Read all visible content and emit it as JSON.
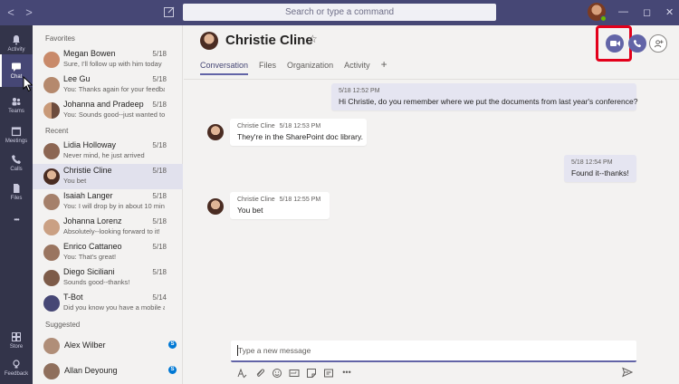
{
  "titlebar": {
    "search_placeholder": "Search or type a command",
    "back_glyph": "<",
    "forward_glyph": ">",
    "minimize_glyph": "—",
    "maximize_glyph": "◻",
    "close_glyph": "✕"
  },
  "rail": {
    "items": [
      {
        "label": "Activity",
        "icon": "bell-icon"
      },
      {
        "label": "Chat",
        "icon": "chat-icon",
        "active": true
      },
      {
        "label": "Teams",
        "icon": "teams-icon"
      },
      {
        "label": "Meetings",
        "icon": "calendar-icon"
      },
      {
        "label": "Calls",
        "icon": "phone-icon"
      },
      {
        "label": "Files",
        "icon": "file-icon"
      },
      {
        "label": "",
        "icon": "more-icon"
      },
      {
        "label": "Store",
        "icon": "store-icon"
      },
      {
        "label": "Feedback",
        "icon": "feedback-icon"
      }
    ],
    "more_glyph": "•••"
  },
  "chatlist": {
    "favorites_label": "Favorites",
    "recent_label": "Recent",
    "suggested_label": "Suggested",
    "favorites": [
      {
        "name": "Megan Bowen",
        "preview": "Sure, I'll follow up with him today",
        "date": "5/18"
      },
      {
        "name": "Lee Gu",
        "preview": "You: Thanks again for your feedback",
        "date": "5/18"
      },
      {
        "name": "Johanna and Pradeep",
        "preview": "You: Sounds good--just wanted to",
        "date": "5/18"
      }
    ],
    "recent": [
      {
        "name": "Lidia Holloway",
        "preview": "Never mind, he just arrived",
        "date": "5/18"
      },
      {
        "name": "Christie Cline",
        "preview": "You bet",
        "date": "5/18"
      },
      {
        "name": "Isaiah Langer",
        "preview": "You: I will drop by in about 10 min",
        "date": "5/18"
      },
      {
        "name": "Johanna Lorenz",
        "preview": "Absolutely--looking forward to it!",
        "date": "5/18"
      },
      {
        "name": "Enrico Cattaneo",
        "preview": "You: That's great!",
        "date": "5/18"
      },
      {
        "name": "Diego Siciliani",
        "preview": "Sounds good--thanks!",
        "date": "5/18"
      },
      {
        "name": "T-Bot",
        "preview": "Did you know you have a mobile a...",
        "date": "5/14"
      }
    ],
    "suggested": [
      {
        "name": "Alex Wilber",
        "badge": "S"
      },
      {
        "name": "Allan Deyoung",
        "badge": "S"
      }
    ]
  },
  "main": {
    "contact_name": "Christie Cline",
    "star_glyph": "☆",
    "tabs": [
      {
        "label": "Conversation",
        "active": true
      },
      {
        "label": "Files"
      },
      {
        "label": "Organization"
      },
      {
        "label": "Activity"
      }
    ],
    "tab_add_glyph": "+",
    "messages": [
      {
        "mine": true,
        "time": "5/18 12:52 PM",
        "text": "Hi Christie, do you remember where we put the documents from last year's conference?"
      },
      {
        "mine": false,
        "sender": "Christie Cline",
        "time": "5/18 12:53 PM",
        "text": "They're in the SharePoint doc library."
      },
      {
        "mine": true,
        "time": "5/18 12:54 PM",
        "text": "Found it--thanks!"
      },
      {
        "mine": false,
        "sender": "Christie Cline",
        "time": "5/18 12:55 PM",
        "text": "You bet"
      }
    ],
    "composer_placeholder": "Type a new message"
  },
  "colors": {
    "titlebar": "#464775",
    "rail": "#33344a",
    "accent": "#6264a7",
    "highlight": "#e3001b",
    "online": "#6bb700"
  }
}
